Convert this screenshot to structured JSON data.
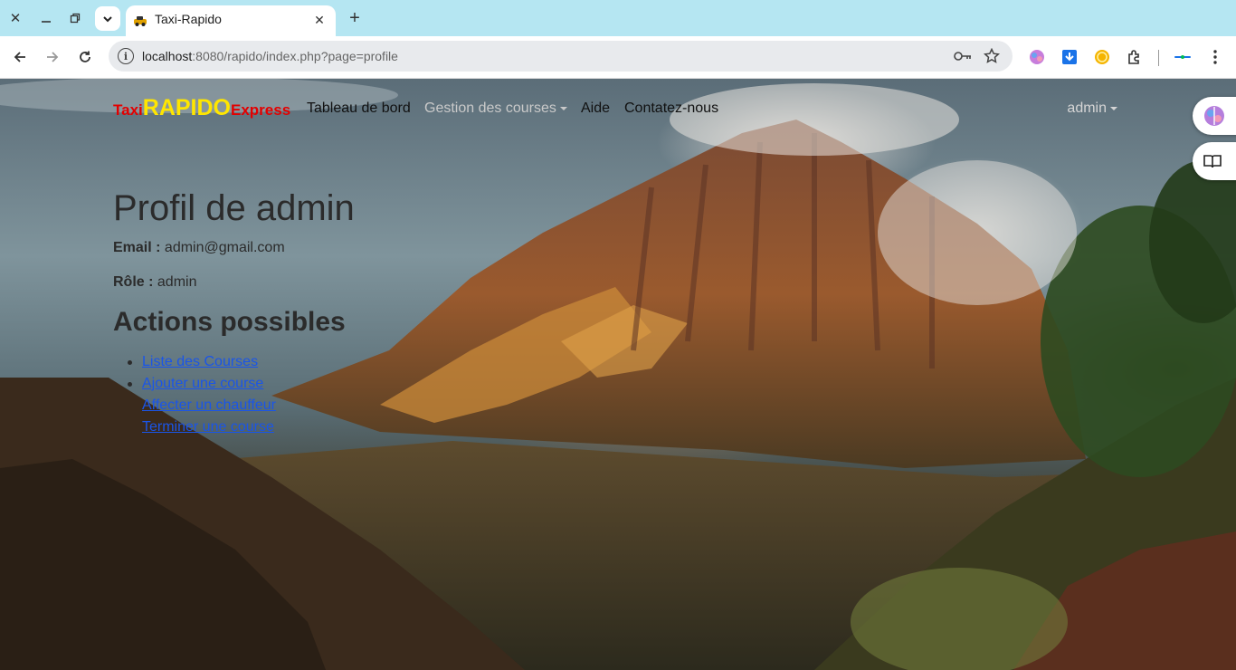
{
  "browser": {
    "tab_title": "Taxi-Rapido",
    "url_host": "localhost",
    "url_rest": ":8080/rapido/index.php?page=profile"
  },
  "navbar": {
    "brand_part1": "Taxi",
    "brand_part2": "RAPIDO",
    "brand_part3": "Express",
    "links": [
      {
        "label": "Tableau de bord"
      },
      {
        "label": "Gestion des courses"
      },
      {
        "label": "Aide"
      },
      {
        "label": "Contatez-nous"
      }
    ],
    "user": "admin"
  },
  "profile": {
    "title": "Profil de admin",
    "email_label": "Email :",
    "email_value": "admin@gmail.com",
    "role_label": "Rôle :",
    "role_value": "admin",
    "actions_title": "Actions possibles",
    "actions": [
      "Liste des Courses",
      "Ajouter une course",
      "Affecter un chauffeur",
      "Terminer une course"
    ]
  },
  "colors": {
    "brand_red": "#e30000",
    "brand_yellow": "#ffe600",
    "link_blue": "#1a55e8",
    "tabbar_bg": "#b5e6f2"
  }
}
